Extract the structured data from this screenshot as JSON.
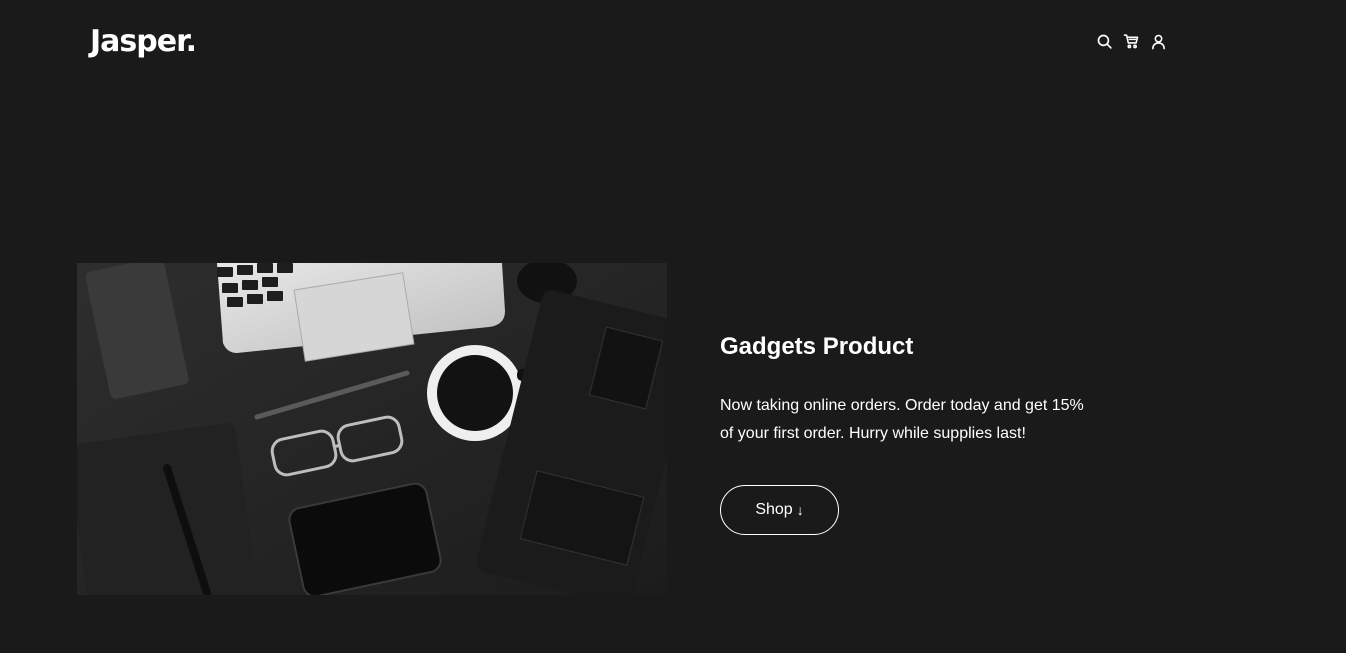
{
  "header": {
    "logo": "Jasper.",
    "icons": [
      "search-icon",
      "cart-icon",
      "user-icon"
    ]
  },
  "hero": {
    "title": "Gadgets Product",
    "description": "Now taking online orders. Order today and get 15% of your first order. Hurry while supplies last!",
    "button_label": "Shop",
    "button_icon": "↓"
  },
  "colors": {
    "background": "#1a1a1a",
    "text": "#ffffff"
  }
}
